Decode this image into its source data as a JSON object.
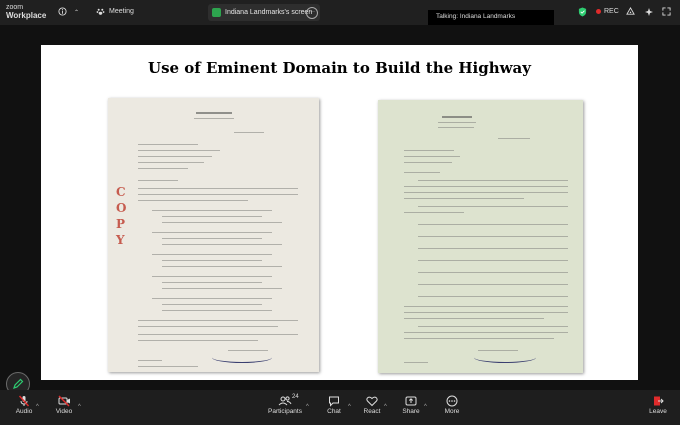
{
  "app": {
    "brand_top": "zoom",
    "brand_bottom": "Workplace"
  },
  "topbar": {
    "meeting_label": "Meeting",
    "share_pill_label": "Indiana Landmarks's screen",
    "talking_label": "Talking: Indiana Landmarks",
    "rec_label": "REC"
  },
  "slide": {
    "title": "Use of Eminent Domain to Build the Highway",
    "left_doc_stamp": "COPY"
  },
  "toolbar": {
    "audio": "Audio",
    "video": "Video",
    "participants": "Participants",
    "participants_count": "24",
    "chat": "Chat",
    "react": "React",
    "share": "Share",
    "more": "More",
    "leave": "Leave"
  },
  "colors": {
    "share_indicator": "#2da44e",
    "shield_green": "#2ecc71",
    "rec_red": "#e02b2b",
    "leave_red": "#e02b2b",
    "muted_red": "#e02b2b"
  }
}
